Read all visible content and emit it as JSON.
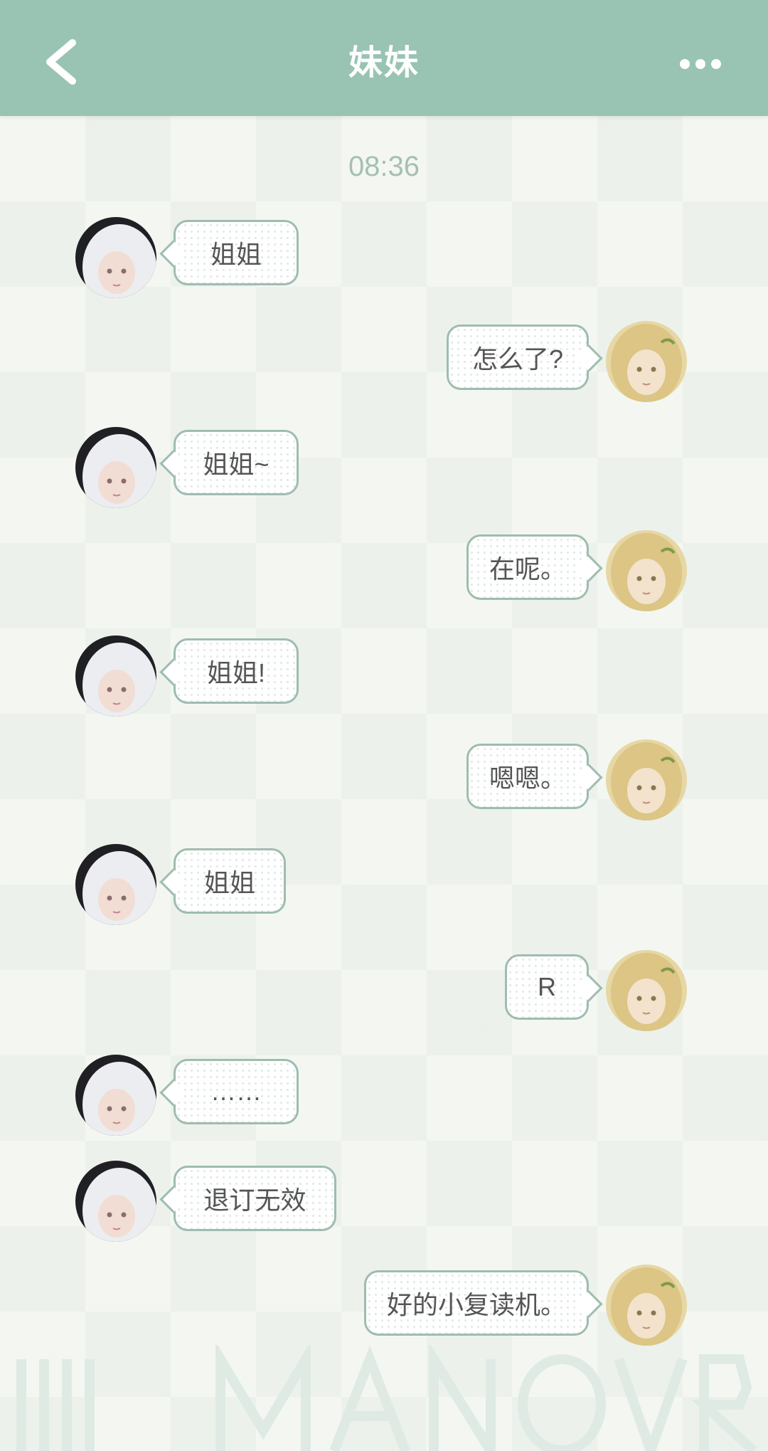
{
  "header": {
    "title": "妹妹",
    "back_icon": "chevron-left-icon",
    "more_icon": "more-horizontal-icon"
  },
  "timestamp": "08:36",
  "messages": [
    {
      "side": "left",
      "text": "姐姐"
    },
    {
      "side": "right",
      "text": "怎么了?"
    },
    {
      "side": "left",
      "text": "姐姐~"
    },
    {
      "side": "right",
      "text": "在呢。"
    },
    {
      "side": "left",
      "text": "姐姐!"
    },
    {
      "side": "right",
      "text": "嗯嗯。"
    },
    {
      "side": "left",
      "text": "姐姐"
    },
    {
      "side": "right",
      "text": "R"
    },
    {
      "side": "left",
      "text": "……"
    },
    {
      "side": "left",
      "text": "退订无效"
    },
    {
      "side": "right",
      "text": "好的小复读机。"
    }
  ],
  "colors": {
    "header_bg": "#99c3b3",
    "bubble_border": "#9fbcb0",
    "timestamp": "#a6bfb5",
    "text": "#555555"
  }
}
